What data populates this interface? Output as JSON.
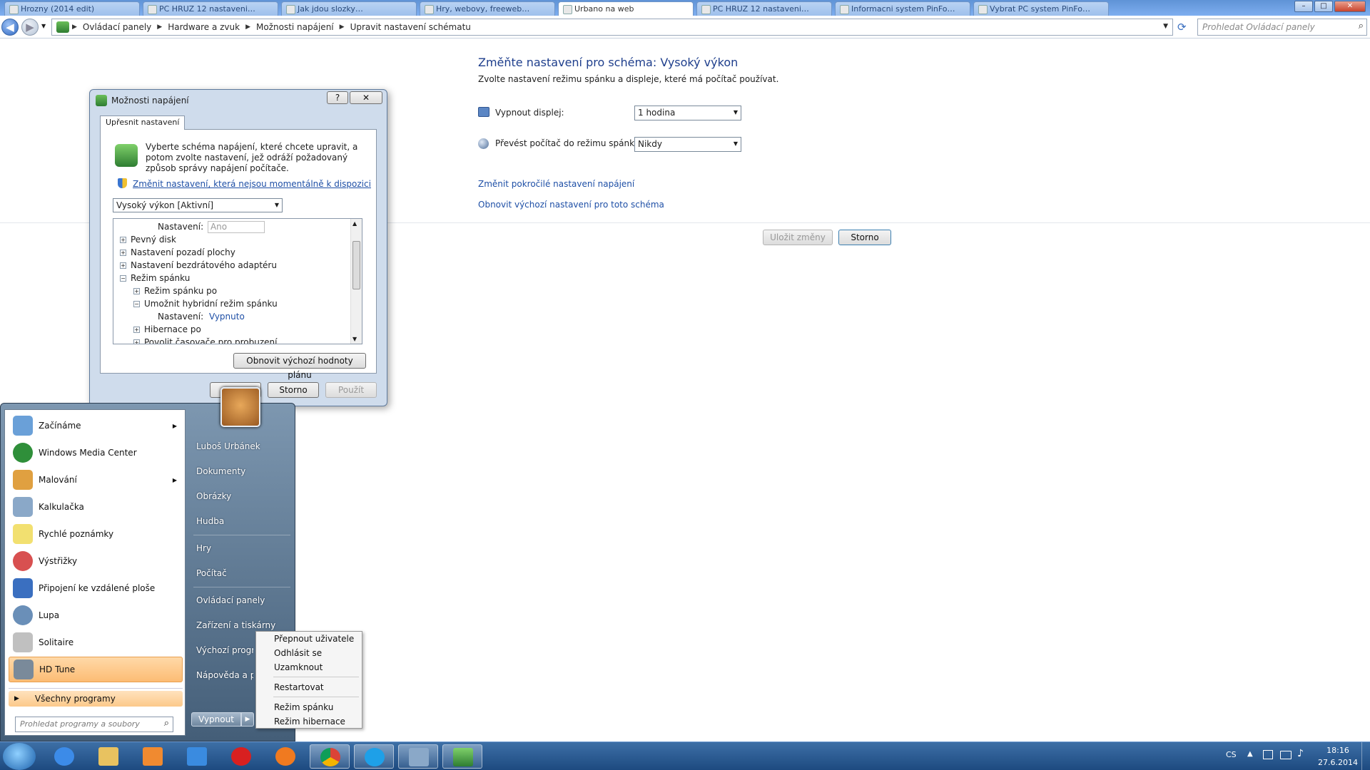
{
  "browser": {
    "tabs": [
      "Hrozny (2014 edit)",
      "PC HRUZ 12 nastaveni…",
      "Jak jdou slozky…",
      "Hry, webovy, freeweb…",
      "Urbano na web",
      "PC HRUZ 12 nastaveni…",
      "Informacni system PinFo…",
      "Vybrat PC system PinFo…"
    ],
    "window_controls": {
      "minimize": "–",
      "maximize": "□",
      "close": "✕"
    }
  },
  "address": {
    "breadcrumbs": [
      "Ovládací panely",
      "Hardware a zvuk",
      "Možnosti napájení",
      "Upravit nastavení schématu"
    ],
    "search_placeholder": "Prohledat Ovládací panely"
  },
  "plan": {
    "title": "Změňte nastavení pro schéma: Vysoký výkon",
    "subtitle": "Zvolte nastavení režimu spánku a displeje, které má počítač používat.",
    "display_label": "Vypnout displej:",
    "display_value": "1 hodina",
    "sleep_label": "Převést počítač do režimu spánku:",
    "sleep_value": "Nikdy",
    "link_advanced": "Změnit pokročilé nastavení napájení",
    "link_restore": "Obnovit výchozí nastavení pro toto schéma",
    "save_button": "Uložit změny",
    "cancel_button": "Storno"
  },
  "dialog": {
    "title": "Možnosti napájení",
    "help": "?",
    "close": "✕",
    "tab": "Upřesnit nastavení",
    "description": "Vyberte schéma napájení, které chcete upravit, a potom zvolte nastavení, jež odráží požadovaný způsob správy napájení počítače.",
    "change_link": "Změnit nastavení, která nejsou momentálně k dispozici",
    "scheme_select": "Vysoký výkon [Aktivní]",
    "tree": {
      "setting_label": "Nastavení:",
      "setting_value_disabled": "Ano",
      "disk": "Pevný disk",
      "desktop": "Nastavení pozadí plochy",
      "wireless": "Nastavení bezdrátového adaptéru",
      "sleep": "Režim spánku",
      "sleep_after": "Režim spánku po",
      "hybrid": "Umožnit hybridní režim spánku",
      "hybrid_value": "Vypnuto",
      "hibernate": "Hibernace po",
      "timers": "Povolit časovače pro probuzení"
    },
    "restore_button": "Obnovit výchozí hodnoty plánu",
    "cancel_button": "Storno",
    "apply_button": "Použít"
  },
  "start_menu": {
    "programs": [
      {
        "label": "Začínáme",
        "has_submenu": true,
        "color": "#6aa0d8"
      },
      {
        "label": "Windows Media Center",
        "has_submenu": false,
        "color": "#2f8f3a"
      },
      {
        "label": "Malování",
        "has_submenu": true,
        "color": "#e0a040"
      },
      {
        "label": "Kalkulačka",
        "has_submenu": false,
        "color": "#8aa8c8"
      },
      {
        "label": "Rychlé poznámky",
        "has_submenu": false,
        "color": "#f2e070"
      },
      {
        "label": "Výstřižky",
        "has_submenu": false,
        "color": "#d85050"
      },
      {
        "label": "Připojení ke vzdálené ploše",
        "has_submenu": false,
        "color": "#3a6fc0"
      },
      {
        "label": "Lupa",
        "has_submenu": false,
        "color": "#6a8fb8"
      },
      {
        "label": "Solitaire",
        "has_submenu": false,
        "color": "#c0c0c0"
      },
      {
        "label": "HD Tune",
        "has_submenu": false,
        "color": "#7a8a9a"
      }
    ],
    "all_programs": "Všechny programy",
    "search_placeholder": "Prohledat programy a soubory",
    "right_items": [
      "Luboš Urbánek",
      "Dokumenty",
      "Obrázky",
      "Hudba",
      "Hry",
      "Počítač",
      "Ovládací panely",
      "Zařízení a tiskárny",
      "Výchozí programy",
      "Nápověda a podpora"
    ],
    "shutdown": "Vypnout"
  },
  "context_menu": [
    "Přepnout uživatele",
    "Odhlásit se",
    "Uzamknout",
    "Restartovat",
    "Režim spánku",
    "Režim hibernace"
  ],
  "taskbar": {
    "language": "CS",
    "time": "18:16",
    "date": "27.6.2014"
  }
}
